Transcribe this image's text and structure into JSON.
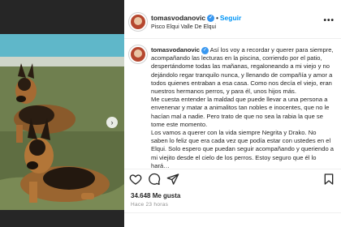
{
  "post": {
    "username": "tomasvodanovic",
    "follow_label": "Seguir",
    "separator": "•",
    "location": "Pisco Elqui Valle De Elqui",
    "more_label": "•••",
    "verified_mark": "✓"
  },
  "caption": {
    "username": "tomasvodanovic",
    "text": " Así los voy a recordar y querer para siempre, acompañando las lecturas en la piscina, corriendo por el patio, despertándome todas las mañanas, regaloneando a mi viejo y no dejándolo regar tranquilo nunca, y llenando de compañía y amor a todos quienes entraban a esa casa. Como nos decía el viejo, eran nuestros hermanos perros, y para él, unos hijos más.\nMe cuesta entender la maldad que puede llevar a una persona a envenenar y matar a animalitos tan nobles e inocentes, que no le hacían mal a nadie. Pero trato de que no sea la rabia la que se tome este momento.\nLos vamos a querer con la vida siempre Negrita y Drako. No saben lo feliz que era cada vez que podía estar con ustedes en el Elqui. Solo espero que puedan seguir acompañando y queriendo a mi viejito desde el cielo de los perros. Estoy seguro que él lo hará…"
  },
  "stats": {
    "likes": "34.648 Me gusta",
    "time": "Hace 23 horas"
  },
  "icons": {
    "like": "heart-icon",
    "comment": "comment-icon",
    "share": "send-icon",
    "save": "bookmark-icon",
    "next": "chevron-right-icon"
  },
  "colors": {
    "accent": "#0095f6",
    "verified": "#3897f0",
    "text": "#262626",
    "muted": "#8e8e8e"
  }
}
